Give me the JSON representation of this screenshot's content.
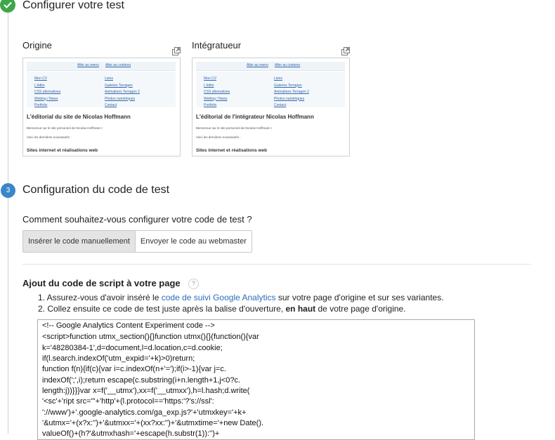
{
  "step1": {
    "title": "Configurer votre test"
  },
  "panels": [
    {
      "label": "Origine",
      "nav": [
        "Aller au menu",
        "Aller au contenu"
      ],
      "menu_left": [
        "Mon CV",
        "L'édito",
        "CSS alternatives",
        "Weblog / News",
        "Portfolio"
      ],
      "menu_right": [
        "Liens",
        "Galeries Terragen",
        "Animations Terragen 2",
        "Photos numériques",
        "Contact"
      ],
      "heading": "L'éditorial du site de Nicolas Hoffmann",
      "text1": "Bienvenue sur le site personnel de Nicolas Hoffmann !",
      "text2": "Voici les dernières nouveautés :",
      "subheading": "Sites internet et réalisations web"
    },
    {
      "label": "Intégratueur",
      "nav": [
        "Aller au menu",
        "Aller au contenu"
      ],
      "menu_left": [
        "Mon CV",
        "L'édito",
        "CSS alternatives",
        "Weblog / News",
        "Portfolio"
      ],
      "menu_right": [
        "Liens",
        "Galeries Terragen",
        "Animations Terragen 2",
        "Photos numériques",
        "Contact"
      ],
      "heading": "L'éditorial de l'intégrateur Nicolas Hoffmann",
      "text1": "Bienvenue sur le site personnel de Nicolas Hoffmann !",
      "text2": "Voici les dernières nouveautés :",
      "subheading": "Sites internet et réalisations web"
    }
  ],
  "step2": {
    "number": "3",
    "title": "Configuration du code de test",
    "question": "Comment souhaitez-vous configurer votre code de test ?",
    "btn_manual": "Insérer le code manuellement",
    "btn_webmaster": "Envoyer le code au webmaster"
  },
  "script_section": {
    "title": "Ajout du code de script à votre page",
    "help": "?",
    "step1_prefix": "1. Assurez-vous d'avoir inséré le ",
    "step1_link": "code de suivi Google Analytics",
    "step1_suffix": " sur votre page d'origine et sur ses variantes.",
    "step2_prefix": "2. Collez ensuite ce code de test juste après la balise d'ouverture, ",
    "step2_bold": "en haut",
    "step2_suffix": " de votre page d'origine."
  },
  "code_lines": [
    "<!-- Google Analytics Content Experiment code -->",
    "<script>function utmx_section(){}function utmx(){}(function(){var",
    "k='48280384-1',d=document,l=d.location,c=d.cookie;",
    "if(l.search.indexOf('utm_expid='+k)>0)return;",
    "function f(n){if(c){var i=c.indexOf(n+'=');if(i>-1){var j=c.",
    "indexOf(';',i);return escape(c.substring(i+n.length+1,j<0?c.",
    "length:j))}}}var x=f('__utmx'),xx=f('__utmxx'),h=l.hash;d.write(",
    "'<sc'+'ript src=\"'+'http'+(l.protocol=='https:'?'s://ssl':",
    "'://www')+'.google-analytics.com/ga_exp.js?'+'utmxkey='+k+",
    "'&utmx='+(x?x:'')+'&utmxx='+(xx?xx:'')+'&utmxtime='+new Date().",
    "valueOf()+(h?'&utmxhash='+escape(h.substr(1)):'')+"
  ]
}
